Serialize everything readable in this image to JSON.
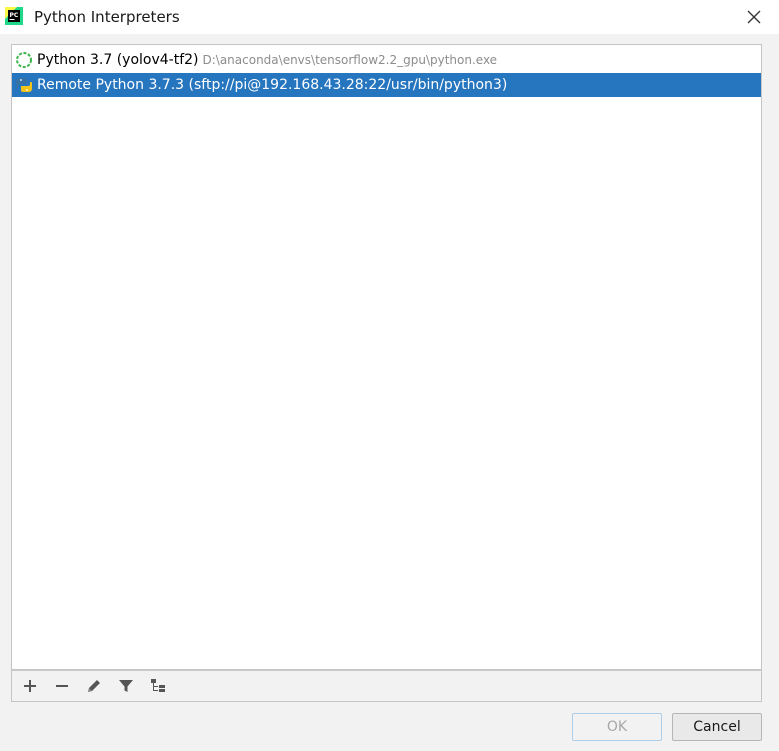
{
  "window": {
    "title": "Python Interpreters",
    "app_icon": "pycharm-icon",
    "close_icon": "close-icon"
  },
  "interpreters": [
    {
      "name": "Python 3.7 (yolov4-tf2)",
      "path": "D:\\anaconda\\envs\\tensorflow2.2_gpu\\python.exe",
      "icon": "loading-spinner-icon",
      "selected": false
    },
    {
      "name": "Remote Python 3.7.3 (sftp://pi@192.168.43.28:22/usr/bin/python3)",
      "path": "",
      "icon": "remote-python-icon",
      "selected": true
    }
  ],
  "toolbar": {
    "icons": [
      "add-icon",
      "remove-icon",
      "edit-icon",
      "filter-icon",
      "show-paths-icon"
    ]
  },
  "buttons": {
    "ok_label": "OK",
    "cancel_label": "Cancel"
  },
  "colors": {
    "selection": "#2675bf",
    "spinner": "#3cb54a",
    "python_blue": "#3572a5",
    "python_yellow": "#f0c419"
  }
}
